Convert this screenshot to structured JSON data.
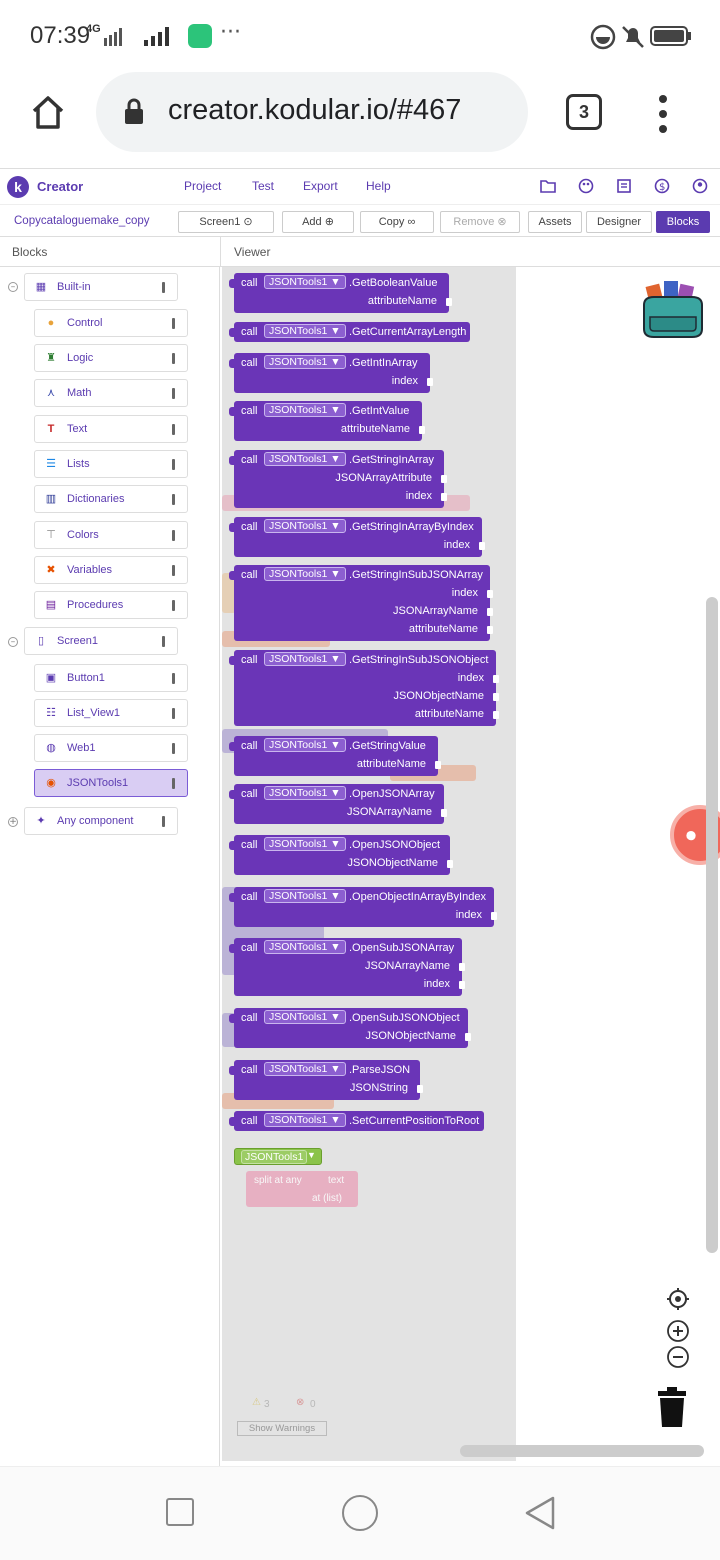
{
  "status_bar": {
    "time": "07:39",
    "network": "4G",
    "dots": "···"
  },
  "browser": {
    "url": "creator.kodular.io/#467",
    "tab_count": "3"
  },
  "app": {
    "brand": "Creator",
    "menu": [
      "Project",
      "Test",
      "Export",
      "Help"
    ],
    "project_name": "Copycataloguemake_copy",
    "screen_select": "Screen1",
    "add_label": "Add",
    "copy_label": "Copy",
    "remove_label": "Remove",
    "assets_label": "Assets",
    "designer_label": "Designer",
    "blocks_label": "Blocks",
    "blocks_header": "Blocks",
    "viewer_header": "Viewer"
  },
  "tree": {
    "builtin": "Built-in",
    "builtin_items": [
      "Control",
      "Logic",
      "Math",
      "Text",
      "Lists",
      "Dictionaries",
      "Colors",
      "Variables",
      "Procedures"
    ],
    "screen": "Screen1",
    "screen_items": [
      "Button1",
      "List_View1",
      "Web1",
      "JSONTools1"
    ],
    "any_component": "Any component"
  },
  "blocks": {
    "call_word": "call",
    "component": "JSONTools1",
    "items": [
      {
        "method": ".GetBooleanValue",
        "params": [
          "attributeName"
        ]
      },
      {
        "method": ".GetCurrentArrayLength",
        "params": []
      },
      {
        "method": ".GetIntInArray",
        "params": [
          "index"
        ]
      },
      {
        "method": ".GetIntValue",
        "params": [
          "attributeName"
        ]
      },
      {
        "method": ".GetStringInArray",
        "params": [
          "JSONArrayAttribute",
          "index"
        ]
      },
      {
        "method": ".GetStringInArrayByIndex",
        "params": [
          "index"
        ]
      },
      {
        "method": ".GetStringInSubJSONArray",
        "params": [
          "index",
          "JSONArrayName",
          "attributeName"
        ]
      },
      {
        "method": ".GetStringInSubJSONObject",
        "params": [
          "index",
          "JSONObjectName",
          "attributeName"
        ]
      },
      {
        "method": ".GetStringValue",
        "params": [
          "attributeName"
        ]
      },
      {
        "method": ".OpenJSONArray",
        "params": [
          "JSONArrayName"
        ]
      },
      {
        "method": ".OpenJSONObject",
        "params": [
          "JSONObjectName"
        ]
      },
      {
        "method": ".OpenObjectInArrayByIndex",
        "params": [
          "index"
        ]
      },
      {
        "method": ".OpenSubJSONArray",
        "params": [
          "JSONArrayName",
          "index"
        ]
      },
      {
        "method": ".OpenSubJSONObject",
        "params": [
          "JSONObjectName"
        ]
      },
      {
        "method": ".ParseJSON",
        "params": [
          "JSONString"
        ]
      },
      {
        "method": ".SetCurrentPositionToRoot",
        "params": []
      }
    ],
    "component_getter": "JSONTools1",
    "ghost_split": "split at any",
    "ghost_text": "text",
    "ghost_at": "at (list)"
  },
  "workspace": {
    "warnings": "3",
    "errors": "0",
    "show_warnings": "Show Warnings"
  }
}
